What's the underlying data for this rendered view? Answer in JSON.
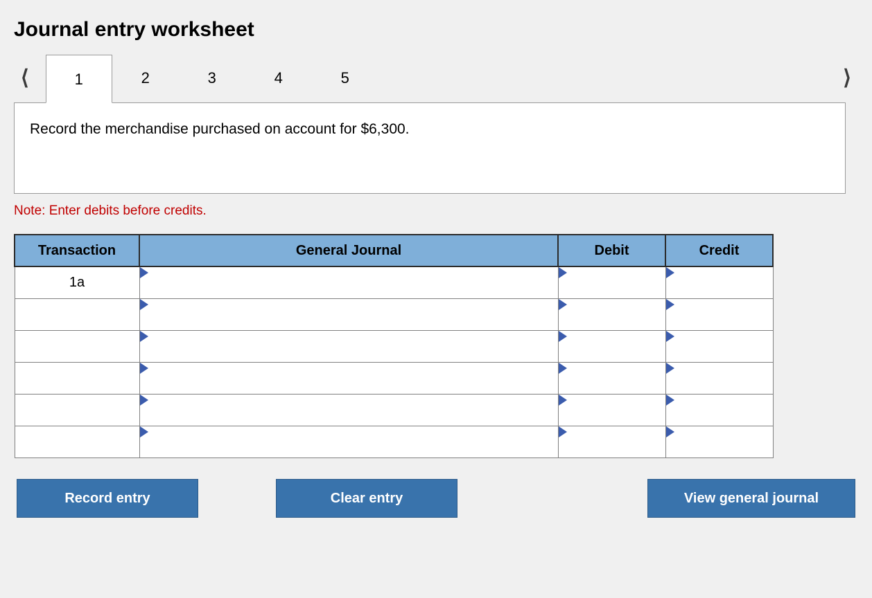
{
  "title": "Journal entry worksheet",
  "nav": {
    "prev": "<",
    "next": ">"
  },
  "tabs": [
    {
      "label": "1",
      "active": true
    },
    {
      "label": "2",
      "active": false
    },
    {
      "label": "3",
      "active": false
    },
    {
      "label": "4",
      "active": false
    },
    {
      "label": "5",
      "active": false
    }
  ],
  "prompt": "Record the merchandise purchased on account for $6,300.",
  "note": "Note: Enter debits before credits.",
  "table": {
    "headers": {
      "transaction": "Transaction",
      "general_journal": "General Journal",
      "debit": "Debit",
      "credit": "Credit"
    },
    "rows": [
      {
        "transaction": "1a",
        "general_journal": "",
        "debit": "",
        "credit": ""
      },
      {
        "transaction": "",
        "general_journal": "",
        "debit": "",
        "credit": ""
      },
      {
        "transaction": "",
        "general_journal": "",
        "debit": "",
        "credit": ""
      },
      {
        "transaction": "",
        "general_journal": "",
        "debit": "",
        "credit": ""
      },
      {
        "transaction": "",
        "general_journal": "",
        "debit": "",
        "credit": ""
      },
      {
        "transaction": "",
        "general_journal": "",
        "debit": "",
        "credit": ""
      }
    ]
  },
  "buttons": {
    "record": "Record entry",
    "clear": "Clear entry",
    "view": "View general journal"
  }
}
